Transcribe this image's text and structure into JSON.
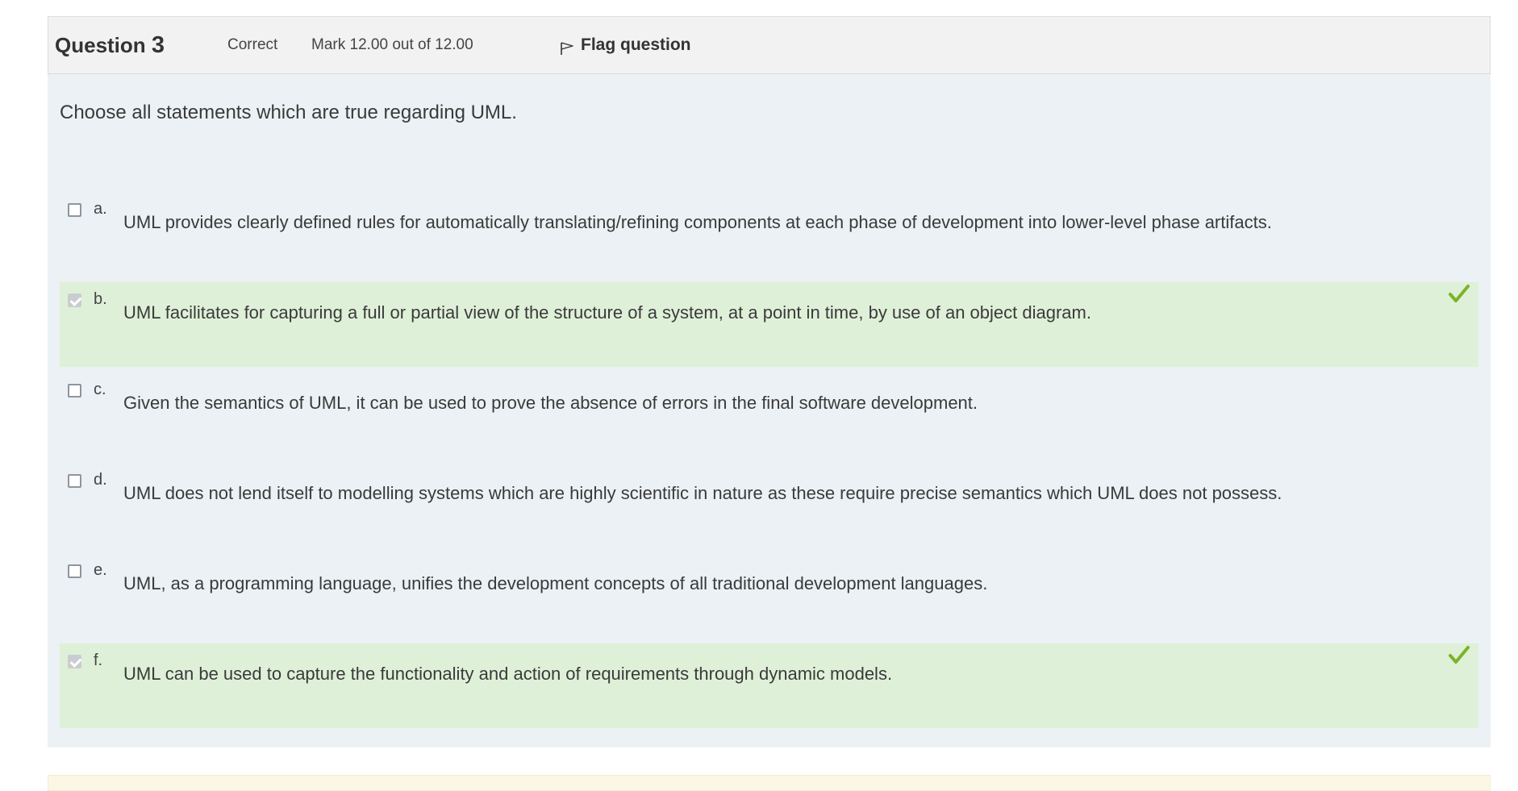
{
  "question": {
    "label": "Question",
    "number": "3",
    "state": "Correct",
    "grade": "Mark 12.00 out of 12.00",
    "flag_label": "Flag question",
    "prompt": "Choose all statements which are true regarding UML."
  },
  "options": [
    {
      "letter": "a.",
      "text": "UML provides clearly defined rules for automatically translating/refining components at each phase of development into lower-level phase artifacts.",
      "checked": false,
      "correct": false
    },
    {
      "letter": "b.",
      "text": "UML facilitates for capturing a full or partial view of the structure of a system, at a point in time, by use of an object diagram.",
      "checked": true,
      "correct": true
    },
    {
      "letter": "c.",
      "text": "Given the semantics of UML, it can be used to prove the absence of errors in the final software development.",
      "checked": false,
      "correct": false
    },
    {
      "letter": "d.",
      "text": "UML does not lend itself to modelling systems which are highly scientific in nature as these require precise semantics which UML does not possess.",
      "checked": false,
      "correct": false
    },
    {
      "letter": "e.",
      "text": "UML, as a programming language, unifies the development concepts of all traditional development languages.",
      "checked": false,
      "correct": false
    },
    {
      "letter": "f.",
      "text": "UML can be used to capture the functionality and action of requirements through dynamic models.",
      "checked": true,
      "correct": true
    }
  ],
  "icons": {
    "flag": "flag-icon",
    "correct": "check-icon"
  },
  "colors": {
    "correct_bg": "#dff0d8",
    "content_bg": "#ebf1f4",
    "tick": "#7ab428"
  }
}
